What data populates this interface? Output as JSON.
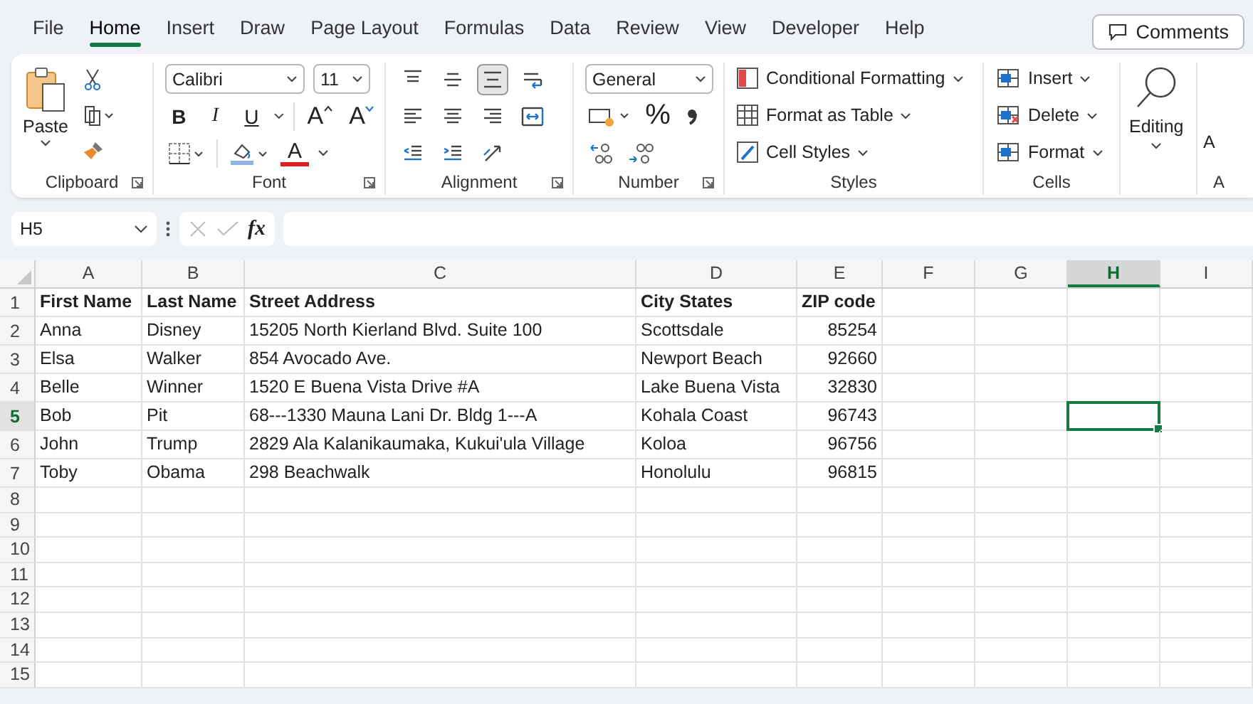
{
  "tabs": [
    {
      "label": "File",
      "selected": false
    },
    {
      "label": "Home",
      "selected": true
    },
    {
      "label": "Insert",
      "selected": false
    },
    {
      "label": "Draw",
      "selected": false
    },
    {
      "label": "Page Layout",
      "selected": false
    },
    {
      "label": "Formulas",
      "selected": false
    },
    {
      "label": "Data",
      "selected": false
    },
    {
      "label": "Review",
      "selected": false
    },
    {
      "label": "View",
      "selected": false
    },
    {
      "label": "Developer",
      "selected": false
    },
    {
      "label": "Help",
      "selected": false
    }
  ],
  "comments_button": "Comments",
  "clipboard": {
    "paste": "Paste",
    "label": "Clipboard"
  },
  "font": {
    "name": "Calibri",
    "size": "11",
    "styles": [
      {
        "label": "B",
        "kind": "bold"
      },
      {
        "label": "I",
        "kind": "italic"
      },
      {
        "label": "U",
        "kind": "underline"
      }
    ],
    "grow": "A",
    "shrink": "A",
    "font_color": "A",
    "label": "Font"
  },
  "alignment": {
    "rows": [
      [
        {
          "kind": "top",
          "selected": false
        },
        {
          "kind": "middle",
          "selected": false
        },
        {
          "kind": "bottom",
          "selected": true
        },
        {
          "kind": "wrap",
          "selected": false
        }
      ],
      [
        {
          "kind": "left",
          "selected": false
        },
        {
          "kind": "center",
          "selected": false
        },
        {
          "kind": "right",
          "selected": false
        },
        {
          "kind": "merge",
          "selected": false
        }
      ],
      [
        {
          "kind": "outdent",
          "selected": false
        },
        {
          "kind": "indent",
          "selected": false
        },
        {
          "kind": "orient",
          "selected": false
        }
      ]
    ],
    "label": "Alignment"
  },
  "number": {
    "format": "General",
    "percent": "%",
    "label": "Number"
  },
  "styles": {
    "items": [
      {
        "label": "Conditional Formatting",
        "kind": "conditional"
      },
      {
        "label": "Format as Table",
        "kind": "table"
      },
      {
        "label": "Cell Styles",
        "kind": "cellstyles"
      }
    ],
    "label": "Styles"
  },
  "cells": {
    "items": [
      {
        "label": "Insert",
        "kind": "insert"
      },
      {
        "label": "Delete",
        "kind": "delete"
      },
      {
        "label": "Format",
        "kind": "format"
      }
    ],
    "label": "Cells"
  },
  "editing": {
    "label": "Editing"
  },
  "cut_group": {
    "button": "A",
    "label": "A"
  },
  "formula_bar": {
    "name_box": "H5",
    "function_label": "fx"
  },
  "grid": {
    "columns": [
      {
        "label": "A",
        "kind": "text",
        "selected": false
      },
      {
        "label": "B",
        "kind": "text",
        "selected": false
      },
      {
        "label": "C",
        "kind": "text",
        "selected": false
      },
      {
        "label": "D",
        "kind": "text",
        "selected": false
      },
      {
        "label": "E",
        "kind": "number",
        "selected": false
      },
      {
        "label": "F",
        "kind": "text",
        "selected": false
      },
      {
        "label": "G",
        "kind": "text",
        "selected": false
      },
      {
        "label": "H",
        "kind": "text",
        "selected": true
      },
      {
        "label": "I",
        "kind": "text",
        "selected": false
      }
    ],
    "rows": [
      {
        "number": "1",
        "header": true,
        "selected": false,
        "cells": [
          "First Name",
          "Last Name",
          "Street Address",
          "City States",
          "ZIP code"
        ]
      },
      {
        "number": "2",
        "header": false,
        "selected": false,
        "cells": [
          "Anna",
          "Disney",
          "15205 North Kierland Blvd. Suite 100",
          "Scottsdale",
          "85254"
        ]
      },
      {
        "number": "3",
        "header": false,
        "selected": false,
        "cells": [
          "Elsa",
          "Walker",
          "854 Avocado Ave.",
          "Newport Beach",
          "92660"
        ]
      },
      {
        "number": "4",
        "header": false,
        "selected": false,
        "cells": [
          "Belle",
          "Winner",
          "1520 E Buena Vista Drive #A",
          "Lake Buena Vista",
          "32830"
        ]
      },
      {
        "number": "5",
        "header": false,
        "selected": true,
        "cells": [
          "Bob",
          "Pit",
          "68---1330 Mauna Lani Dr. Bldg 1---A",
          "Kohala Coast",
          "96743"
        ]
      },
      {
        "number": "6",
        "header": false,
        "selected": false,
        "cells": [
          "John",
          "Trump",
          "2829 Ala Kalanikaumaka, Kukui'ula Village",
          "Koloa",
          "96756"
        ]
      },
      {
        "number": "7",
        "header": false,
        "selected": false,
        "cells": [
          "Toby",
          "Obama",
          "298 Beachwalk",
          "Honolulu",
          "96815"
        ]
      },
      {
        "number": "8",
        "header": false,
        "selected": false,
        "cells": []
      },
      {
        "number": "9",
        "header": false,
        "selected": false,
        "cells": []
      },
      {
        "number": "10",
        "header": false,
        "selected": false,
        "cells": []
      },
      {
        "number": "11",
        "header": false,
        "selected": false,
        "cells": []
      },
      {
        "number": "12",
        "header": false,
        "selected": false,
        "cells": []
      },
      {
        "number": "13",
        "header": false,
        "selected": false,
        "cells": []
      },
      {
        "number": "14",
        "header": false,
        "selected": false,
        "cells": []
      },
      {
        "number": "15",
        "header": false,
        "selected": false,
        "cells": []
      }
    ]
  }
}
